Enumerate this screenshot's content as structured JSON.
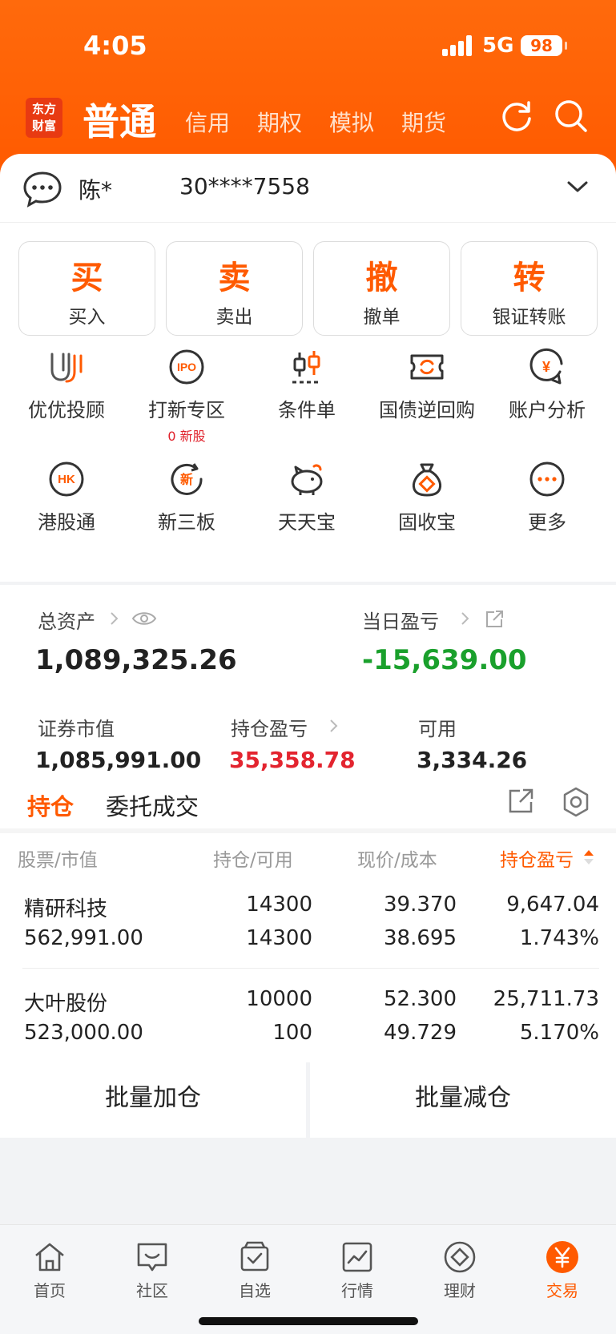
{
  "status_bar": {
    "time": "4:05",
    "network": "5G",
    "battery": "98"
  },
  "nav": {
    "logo": [
      "东方",
      "财富"
    ],
    "active_tab": "普通",
    "tabs": [
      "信用",
      "期权",
      "模拟",
      "期货"
    ]
  },
  "account": {
    "name": "陈*",
    "number": "30****7558"
  },
  "trade_buttons": [
    {
      "glyph": "买",
      "label": "买入"
    },
    {
      "glyph": "卖",
      "label": "卖出"
    },
    {
      "glyph": "撤",
      "label": "撤单"
    },
    {
      "glyph": "转",
      "label": "银证转账"
    }
  ],
  "functions": [
    {
      "label": "优优投顾",
      "icon": "advisor-icon"
    },
    {
      "label": "打新专区",
      "icon": "ipo-icon",
      "sub": "0 新股",
      "icon_text": "IPO"
    },
    {
      "label": "条件单",
      "icon": "condition-order-icon"
    },
    {
      "label": "国债逆回购",
      "icon": "repo-icon"
    },
    {
      "label": "账户分析",
      "icon": "account-analysis-icon",
      "icon_text": "¥"
    },
    {
      "label": "港股通",
      "icon": "hk-icon",
      "icon_text": "HK"
    },
    {
      "label": "新三板",
      "icon": "new-board-icon",
      "icon_text": "新"
    },
    {
      "label": "天天宝",
      "icon": "piggy-bank-icon"
    },
    {
      "label": "固收宝",
      "icon": "money-bag-icon"
    },
    {
      "label": "更多",
      "icon": "more-icon"
    }
  ],
  "assets": {
    "total_label": "总资产",
    "total_value": "1,089,325.26",
    "daily_label": "当日盈亏",
    "daily_value": "-15,639.00",
    "market_label": "证券市值",
    "market_value": "1,085,991.00",
    "position_pl_label": "持仓盈亏",
    "position_pl_value": "35,358.78",
    "available_label": "可用",
    "available_value": "3,334.26"
  },
  "positions": {
    "tab_active": "持仓",
    "tab_other": "委托成交",
    "headers": {
      "stock": "股票/市值",
      "qty": "持仓/可用",
      "price": "现价/成本",
      "pl": "持仓盈亏"
    },
    "rows": [
      {
        "name": "精研科技",
        "market_value": "562,991.00",
        "holding": "14300",
        "available": "14300",
        "price": "39.370",
        "cost": "38.695",
        "pl": "9,647.04",
        "pl_pct": "1.743%"
      },
      {
        "name": "大叶股份",
        "market_value": "523,000.00",
        "holding": "10000",
        "available": "100",
        "price": "52.300",
        "cost": "49.729",
        "pl": "25,711.73",
        "pl_pct": "5.170%"
      }
    ]
  },
  "batch": {
    "add": "批量加仓",
    "reduce": "批量减仓"
  },
  "bottom_nav": [
    {
      "label": "首页",
      "icon": "home-icon"
    },
    {
      "label": "社区",
      "icon": "community-icon"
    },
    {
      "label": "自选",
      "icon": "watchlist-icon"
    },
    {
      "label": "行情",
      "icon": "market-icon"
    },
    {
      "label": "理财",
      "icon": "wealth-icon"
    },
    {
      "label": "交易",
      "icon": "trade-icon",
      "active": true
    }
  ],
  "colors": {
    "brand": "#ff5a00",
    "up": "#e3242f",
    "down": "#1aa02c"
  }
}
